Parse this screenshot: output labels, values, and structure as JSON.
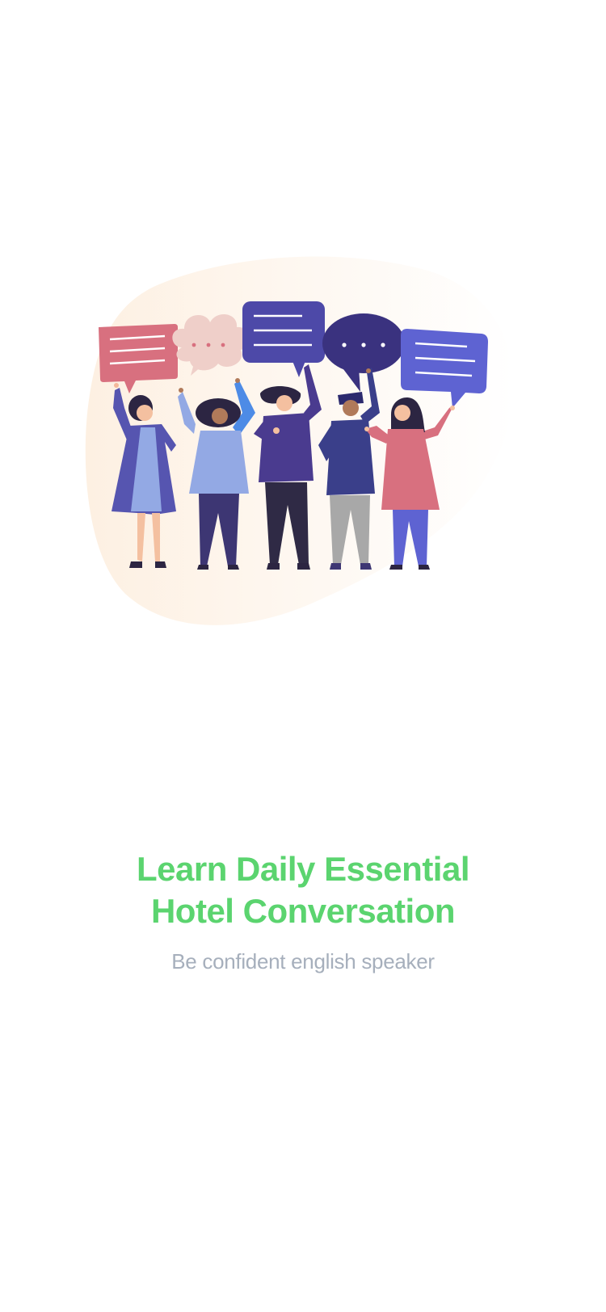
{
  "onboarding": {
    "title_line_1": "Learn Daily Essential",
    "title_line_2": "Hotel Conversation",
    "subtitle": "Be confident english speaker"
  },
  "illustration": {
    "icon": "people-conversation-illustration"
  },
  "colors": {
    "title": "#5bd46f",
    "subtitle": "#a6afbc",
    "background": "#ffffff",
    "blob": "#fdf4ea",
    "bubble_pink": "#d8707f",
    "bubble_cloud": "#efcfc9",
    "bubble_indigo": "#4d49a8",
    "bubble_dark": "#3a327f",
    "bubble_blue": "#5e63d2"
  }
}
